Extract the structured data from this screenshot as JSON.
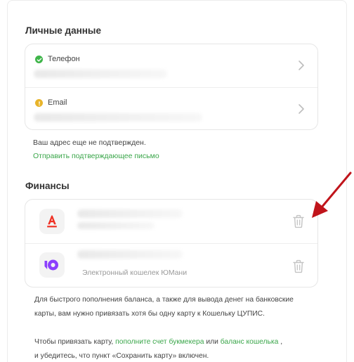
{
  "personal": {
    "title": "Личные данные",
    "phone_label": "Телефон",
    "email_label": "Email",
    "unconfirmed_note": "Ваш адрес еще не подтвержден.",
    "send_confirm_link": "Отправить подтверждающее письмо"
  },
  "finance": {
    "title": "Финансы",
    "wallet_caption": "Электронный кошелек ЮMани",
    "info_text_1": "Для быстрого пополнения баланса, а также для вывода денег на банковские карты, вам нужно привязать хотя бы одну карту к Кошельку ЦУПИС.",
    "info_text_2_prefix": "Чтобы привязать карту, ",
    "info_link_1": "пополните счет букмекера",
    "info_text_2_mid": " или ",
    "info_link_2": "баланс кошелька",
    "info_text_2_suffix": " ,",
    "info_text_3": "и убедитесь, что пункт «Сохранить карту» включен."
  },
  "colors": {
    "accent_green": "#3aa64a",
    "status_ok": "#3fb54a",
    "status_warn": "#e8b42a",
    "alfa_red": "#ef3124",
    "yoomoney_purple": "#8b3ffd",
    "annotation_arrow": "#c0141b"
  },
  "icons": {
    "phone_status": "check-circle-icon",
    "email_status": "warning-circle-icon",
    "row_chevron": "chevron-right-icon",
    "bank_card": "alfa-bank-logo",
    "wallet": "yoomoney-logo",
    "remove": "trash-icon"
  }
}
